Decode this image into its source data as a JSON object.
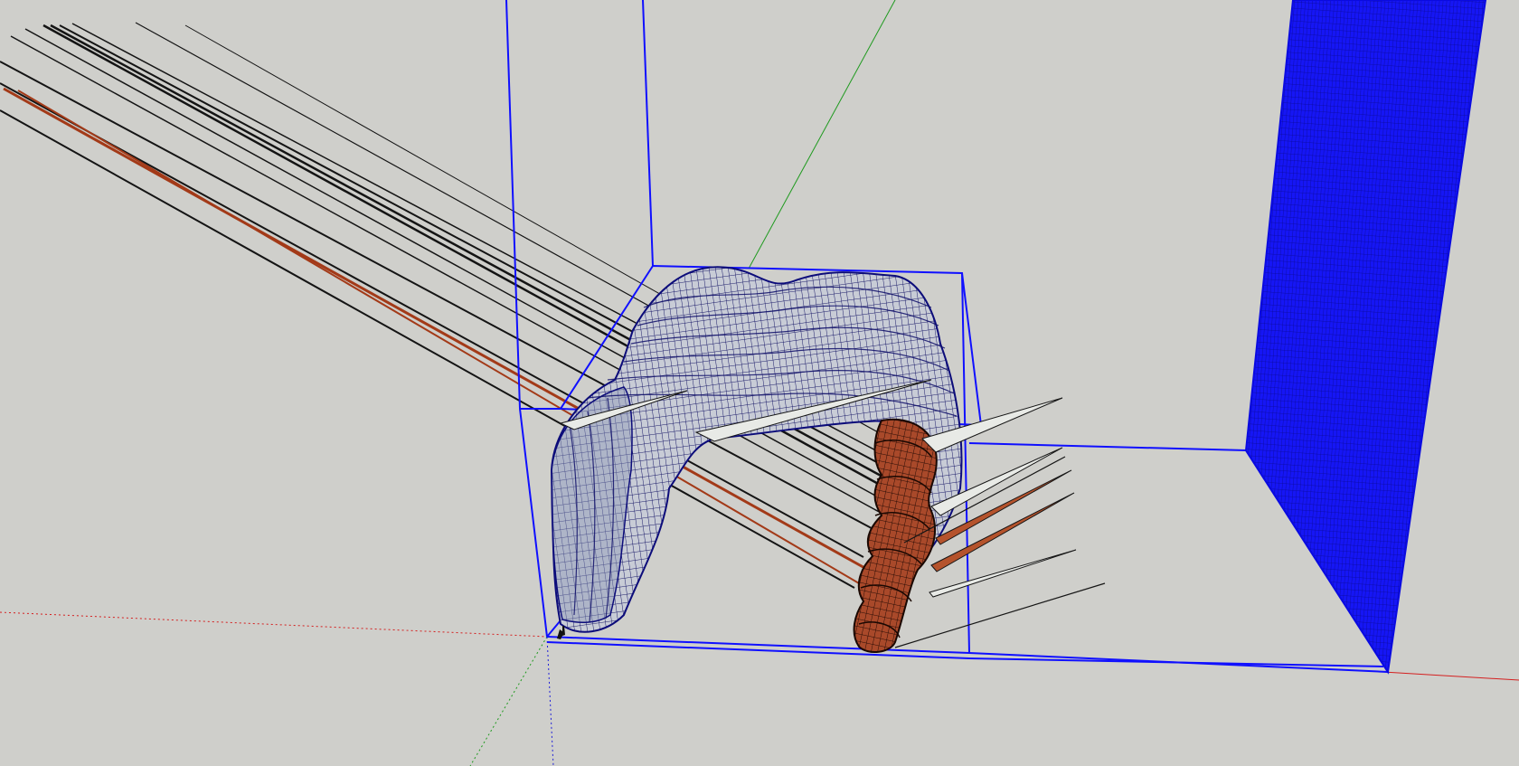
{
  "viewport": {
    "background": "#cfcfcb",
    "selection_color": "#1010ff",
    "face_front_color": "#e2e4ea",
    "face_back_color": "#b5532c",
    "edge_color": "#1a1a1a"
  },
  "axes": {
    "red_axis_color": "#d42020",
    "green_axis_color": "#1f9a1f",
    "blue_axis_color": "#1f1fd8"
  },
  "icons": {
    "origin_figure": "origin-figure-icon"
  }
}
